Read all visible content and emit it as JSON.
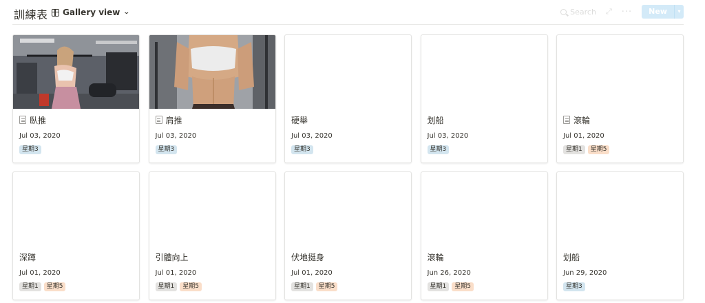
{
  "header": {
    "title": "訓練表",
    "view_label": "Gallery view",
    "search_label": "Search",
    "new_label": "New"
  },
  "colors": {
    "tag_blue": "#d3e5ef",
    "tag_gray": "#e3e2e0",
    "tag_orange": "#fadec9",
    "new_button": "#d3eaf8"
  },
  "cards": [
    {
      "title": "臥推",
      "date": "Jul 03, 2020",
      "tags": [
        "星期3"
      ],
      "has_page_icon": true,
      "cover": "photo-woman-lat-machine"
    },
    {
      "title": "肩推",
      "date": "Jul 03, 2020",
      "tags": [
        "星期3"
      ],
      "has_page_icon": true,
      "cover": "photo-woman-torso"
    },
    {
      "title": "硬舉",
      "date": "Jul 03, 2020",
      "tags": [
        "星期3"
      ],
      "has_page_icon": false
    },
    {
      "title": "划船",
      "date": "Jul 03, 2020",
      "tags": [
        "星期3"
      ],
      "has_page_icon": false
    },
    {
      "title": "滾輪",
      "date": "Jul 01, 2020",
      "tags": [
        "星期1",
        "星期5"
      ],
      "has_page_icon": true
    },
    {
      "title": "深蹲",
      "date": "Jul 01, 2020",
      "tags": [
        "星期1",
        "星期5"
      ],
      "has_page_icon": false
    },
    {
      "title": "引體向上",
      "date": "Jul 01, 2020",
      "tags": [
        "星期1",
        "星期5"
      ],
      "has_page_icon": false
    },
    {
      "title": "伏地挺身",
      "date": "Jul 01, 2020",
      "tags": [
        "星期1",
        "星期5"
      ],
      "has_page_icon": false
    },
    {
      "title": "滾輪",
      "date": "Jun 26, 2020",
      "tags": [
        "星期1",
        "星期5"
      ],
      "has_page_icon": false
    },
    {
      "title": "划船",
      "date": "Jun 29, 2020",
      "tags": [
        "星期3"
      ],
      "has_page_icon": false
    }
  ]
}
